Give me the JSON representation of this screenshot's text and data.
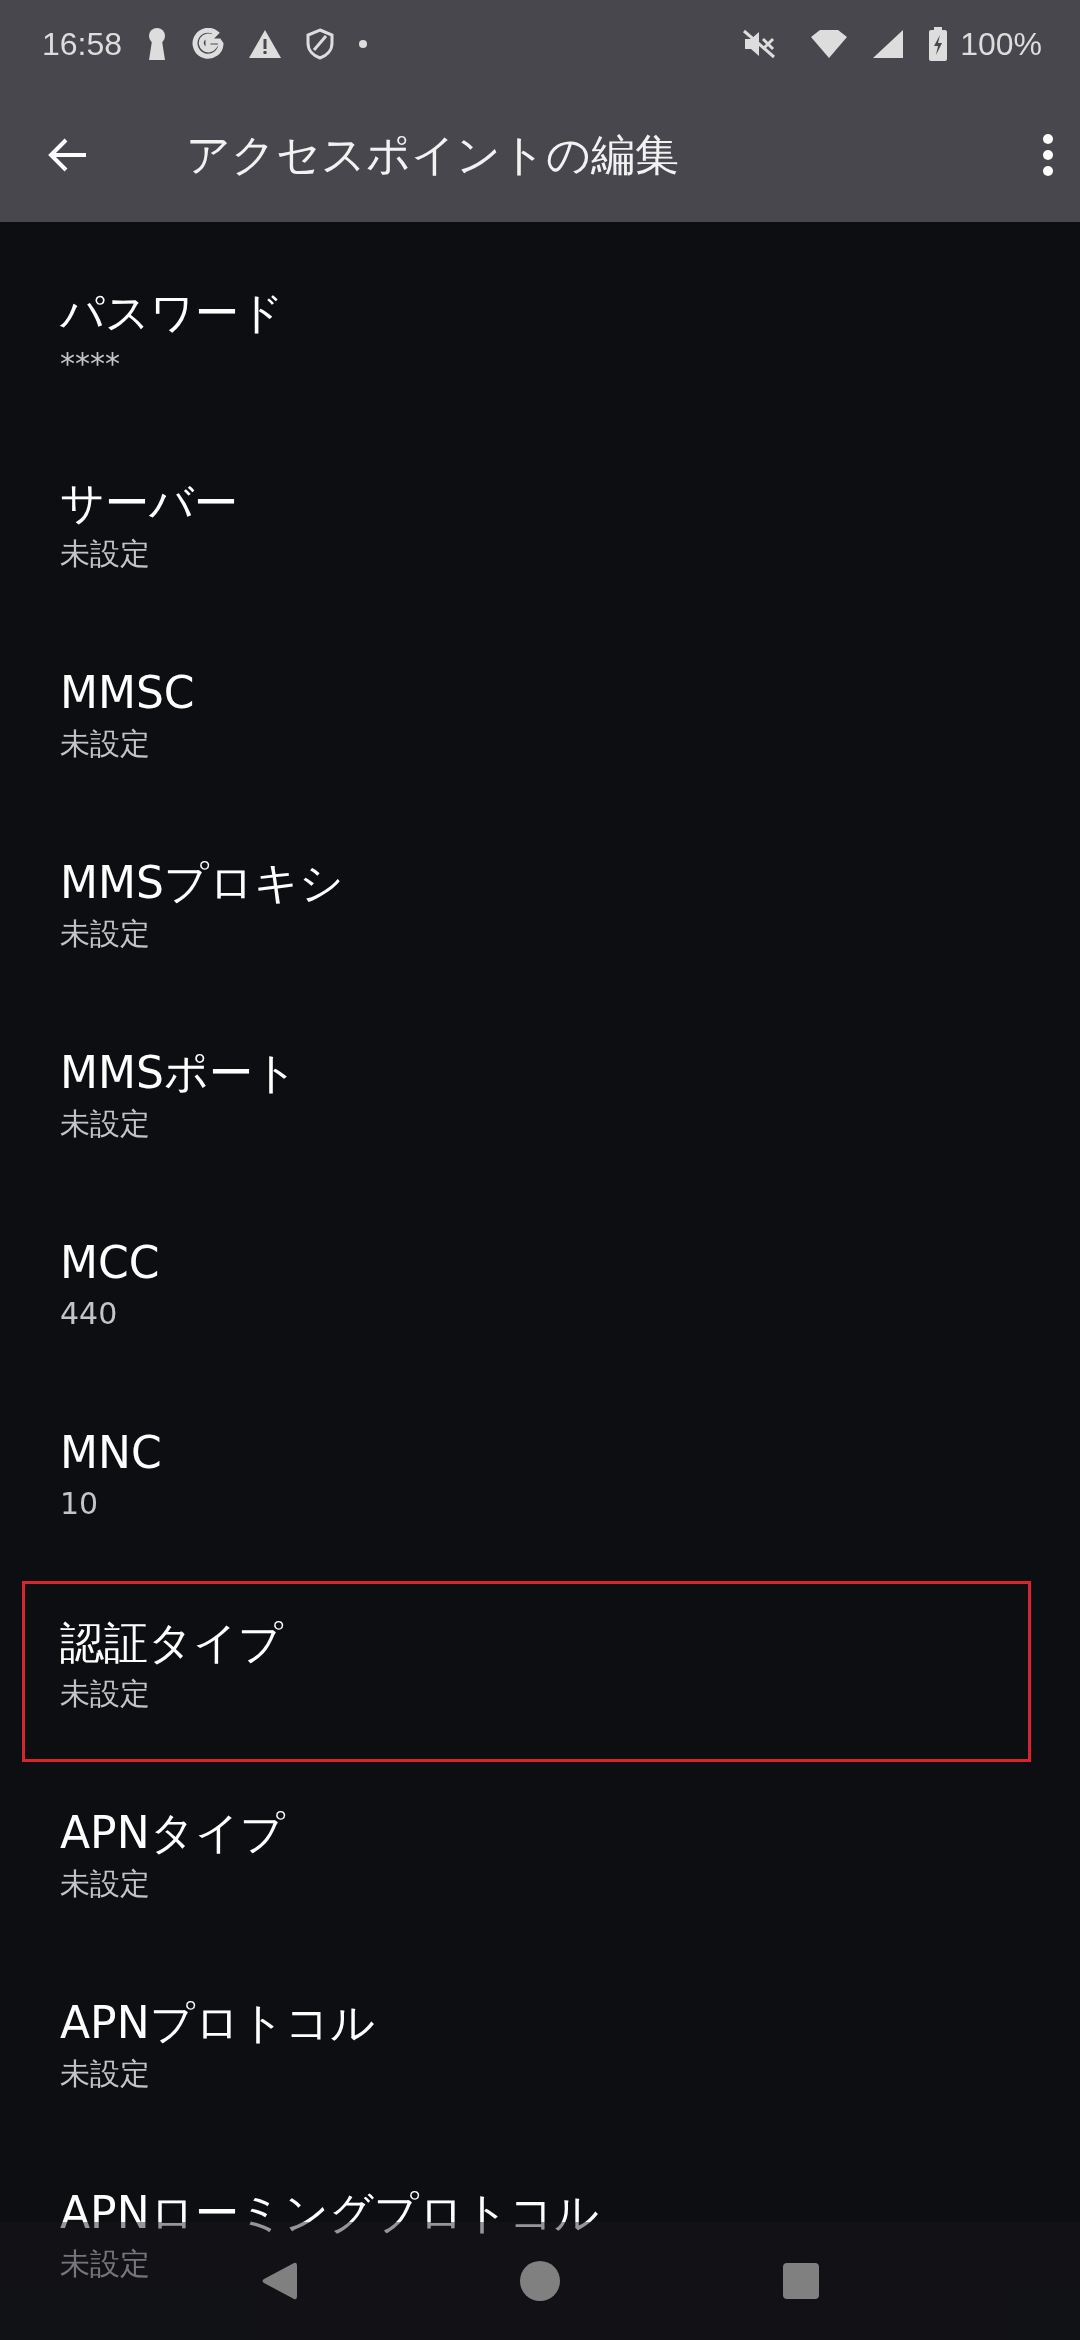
{
  "status_bar": {
    "time": "16:58",
    "battery": "100%"
  },
  "toolbar": {
    "title": "アクセスポイントの編集"
  },
  "settings": [
    {
      "title": "パスワード",
      "summary": "****",
      "highlighted": false
    },
    {
      "title": "サーバー",
      "summary": "未設定",
      "highlighted": false
    },
    {
      "title": "MMSC",
      "summary": "未設定",
      "highlighted": false
    },
    {
      "title": "MMSプロキシ",
      "summary": "未設定",
      "highlighted": false
    },
    {
      "title": "MMSポート",
      "summary": "未設定",
      "highlighted": false
    },
    {
      "title": "MCC",
      "summary": "440",
      "highlighted": false
    },
    {
      "title": "MNC",
      "summary": "10",
      "highlighted": false
    },
    {
      "title": "認証タイプ",
      "summary": "未設定",
      "highlighted": true
    },
    {
      "title": "APNタイプ",
      "summary": "未設定",
      "highlighted": false
    },
    {
      "title": "APNプロトコル",
      "summary": "未設定",
      "highlighted": false
    },
    {
      "title": "APNローミングプロトコル",
      "summary": "未設定",
      "highlighted": false
    }
  ]
}
